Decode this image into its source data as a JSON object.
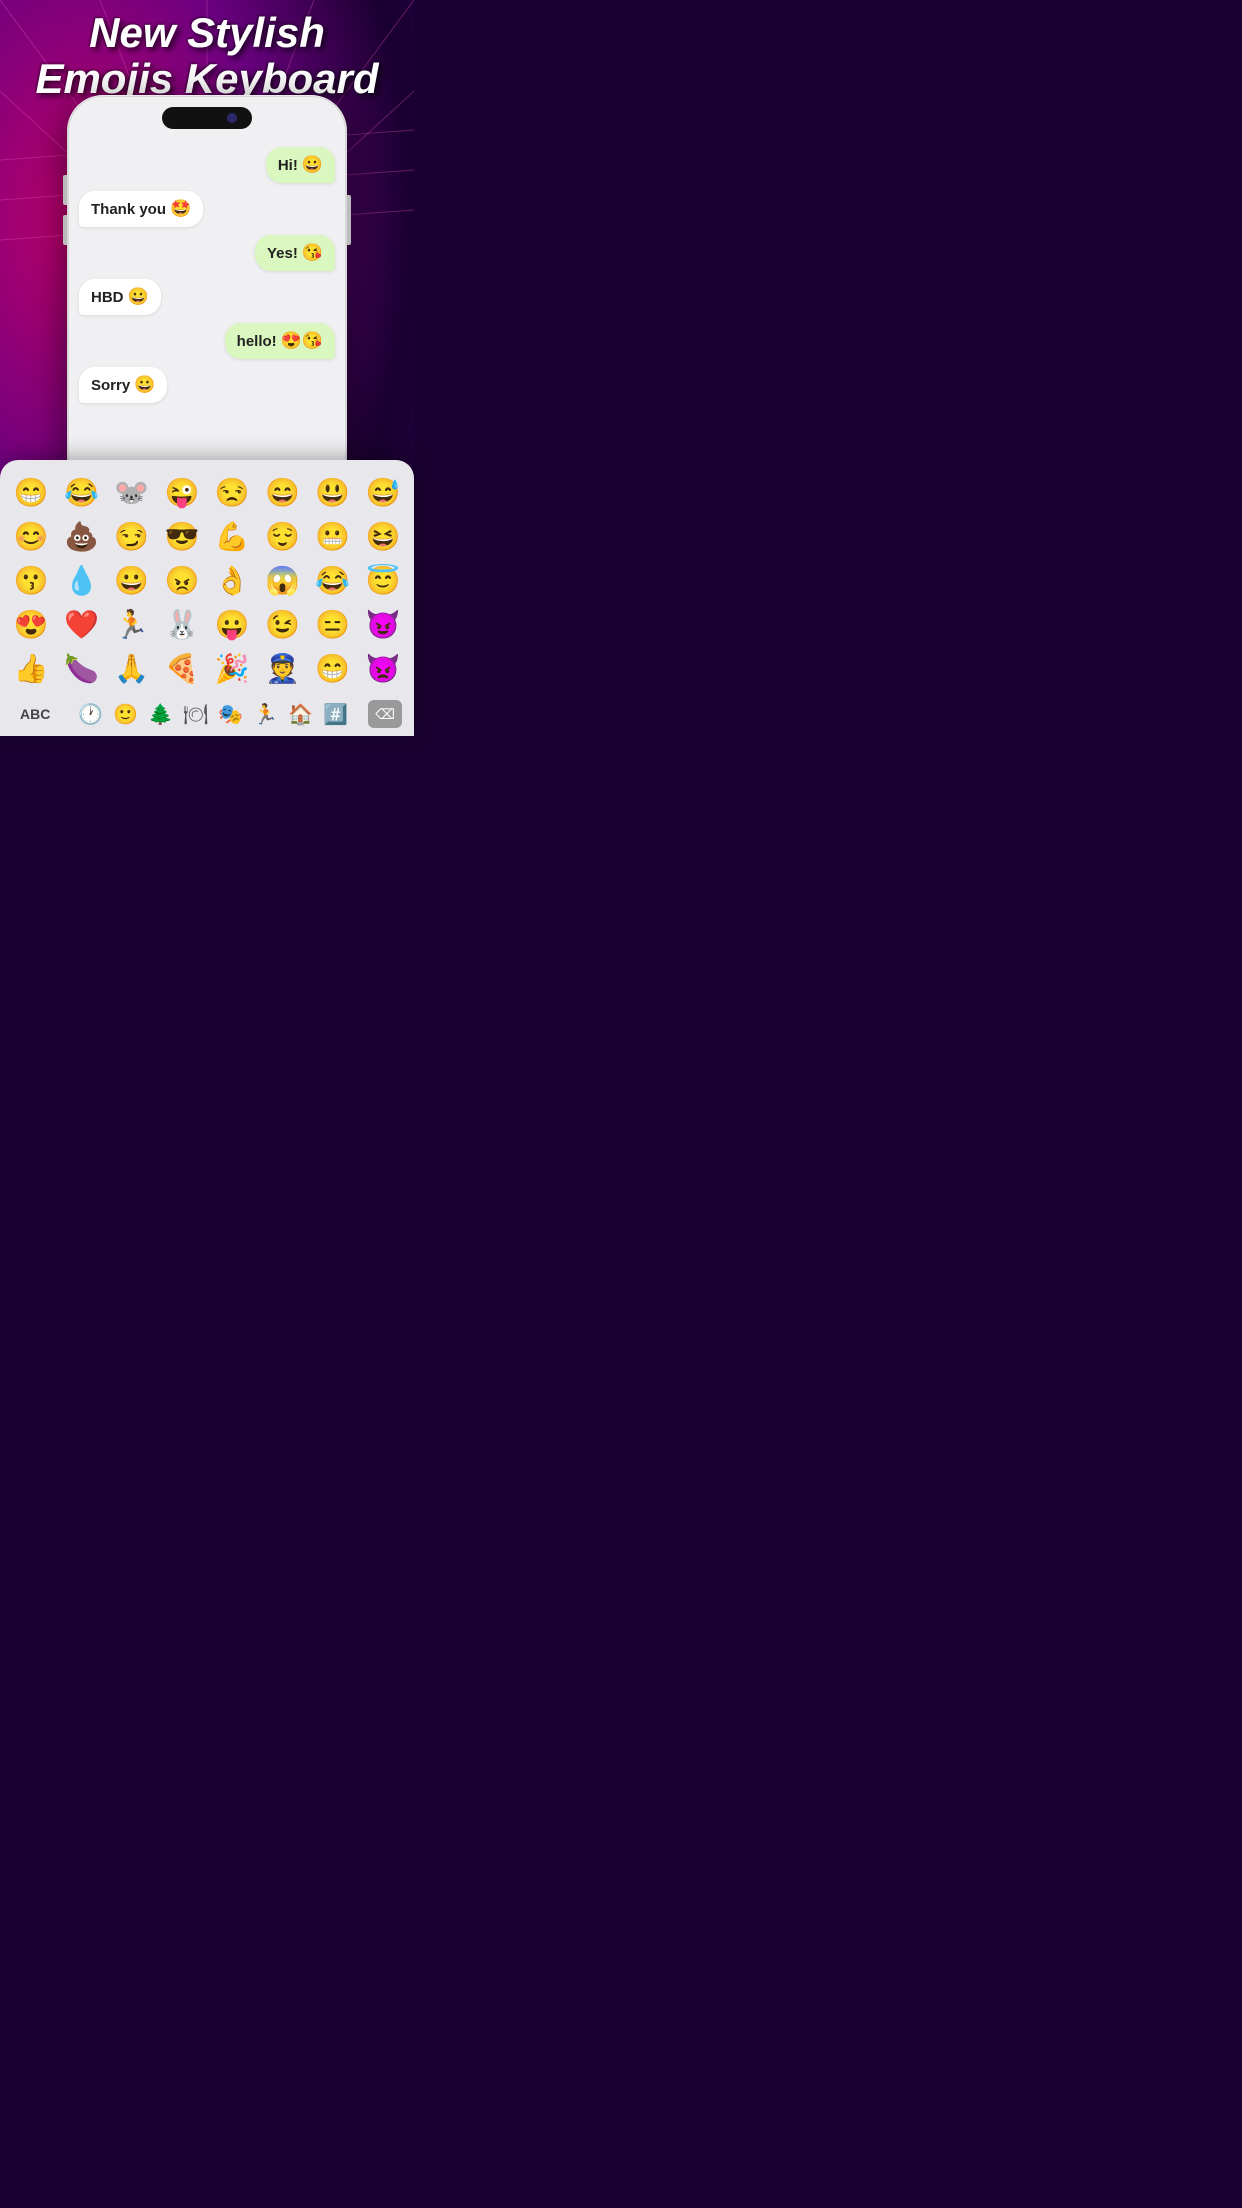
{
  "app": {
    "title_line1": "New Stylish",
    "title_line2": "Emojis Keyboard"
  },
  "chat": {
    "messages": [
      {
        "id": 1,
        "type": "sent",
        "text": "Hi!",
        "emoji": "😀"
      },
      {
        "id": 2,
        "type": "received",
        "text": "Thank you",
        "emoji": "🤩"
      },
      {
        "id": 3,
        "type": "sent",
        "text": "Yes!",
        "emoji": "😘"
      },
      {
        "id": 4,
        "type": "received",
        "text": "HBD",
        "emoji": "😀"
      },
      {
        "id": 5,
        "type": "sent",
        "text": "hello!",
        "emoji": "😍😘"
      },
      {
        "id": 6,
        "type": "received",
        "text": "Sorry",
        "emoji": "😀"
      }
    ]
  },
  "keyboard": {
    "abc_label": "ABC",
    "delete_label": "⌫",
    "emojis": [
      "😁",
      "😂",
      "🐭",
      "😜",
      "😒",
      "😄",
      "😃",
      "😅",
      "😊",
      "💩",
      "😏",
      "😎",
      "💪",
      "😌",
      "😬",
      "😆",
      "😗",
      "💧",
      "😀",
      "😠",
      "👌",
      "😱",
      "😂",
      "😇",
      "😍",
      "❤️",
      "🏃",
      "🐰",
      "😛",
      "😉",
      "😑",
      "😈",
      "👍",
      "🍆",
      "🙏",
      "🍕",
      "🎉",
      "👮",
      "😁",
      "👿"
    ]
  }
}
